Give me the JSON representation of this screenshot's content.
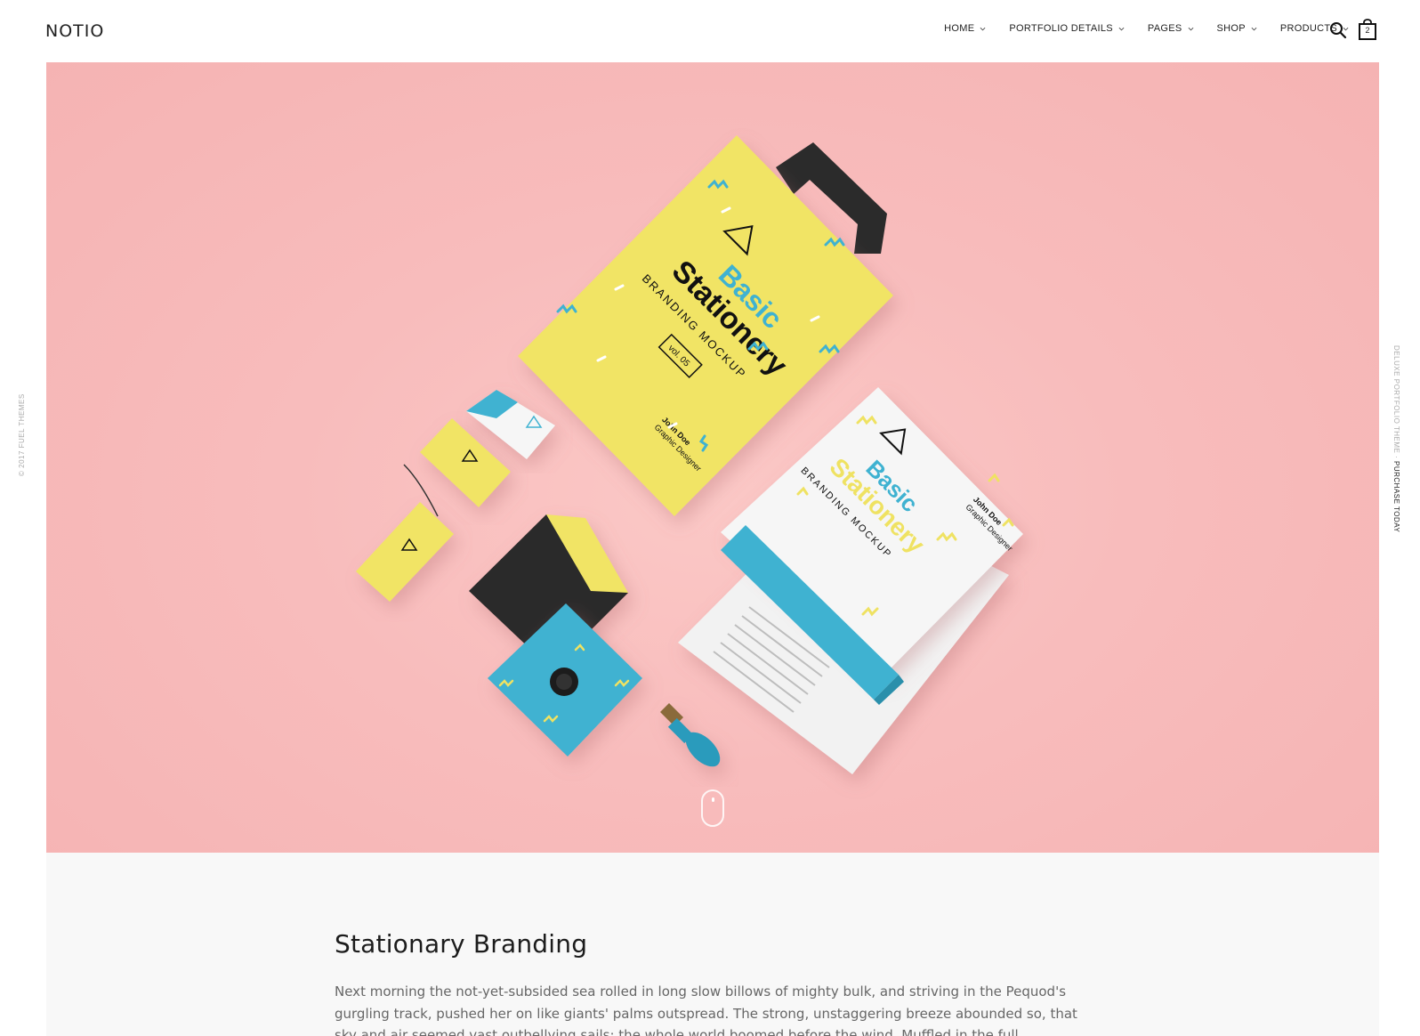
{
  "header": {
    "logo": "NOTIO",
    "nav": [
      {
        "label": "HOME"
      },
      {
        "label": "PORTFOLIO DETAILS"
      },
      {
        "label": "PAGES"
      },
      {
        "label": "SHOP"
      },
      {
        "label": "PRODUCTS"
      }
    ],
    "search_icon": "search-icon",
    "cart_icon": "shopping-bag-icon",
    "cart_count": "2"
  },
  "side": {
    "left_text": "© 2017 FUEL THEMES",
    "right_text": "DELUXE PORTFOLIO THEME · ",
    "right_link": "PURCHASE TODAY"
  },
  "hero": {
    "background_color": "#f5b3b3",
    "image_text": {
      "bag_brand_line1": "Basic",
      "bag_brand_line2": "Stationery",
      "bag_subtitle": "BRANDING MOCKUP",
      "bag_volume": "vol. 05",
      "bag_name": "John Doe",
      "bag_role": "Graphic Designer",
      "letter_brand_line1": "Basic",
      "letter_brand_line2": "Stationery",
      "letter_subtitle": "BRANDING MOCKUP",
      "letter_name": "John Doe",
      "letter_role": "Graphic Designer"
    }
  },
  "content": {
    "title": "Stationary Branding",
    "paragraph": "Next morning the not-yet-subsided sea rolled in long slow billows of mighty bulk, and striving in the Pequod's gurgling track, pushed her on like giants' palms outspread. The strong, unstaggering breeze abounded so, that sky and air seemed vast outbellying sails; the whole world boomed before the wind. Muffled in the full morning light, the"
  },
  "colors": {
    "accent_yellow": "#efe262",
    "accent_blue": "#3fb2d1",
    "dark": "#2b2b2b"
  }
}
